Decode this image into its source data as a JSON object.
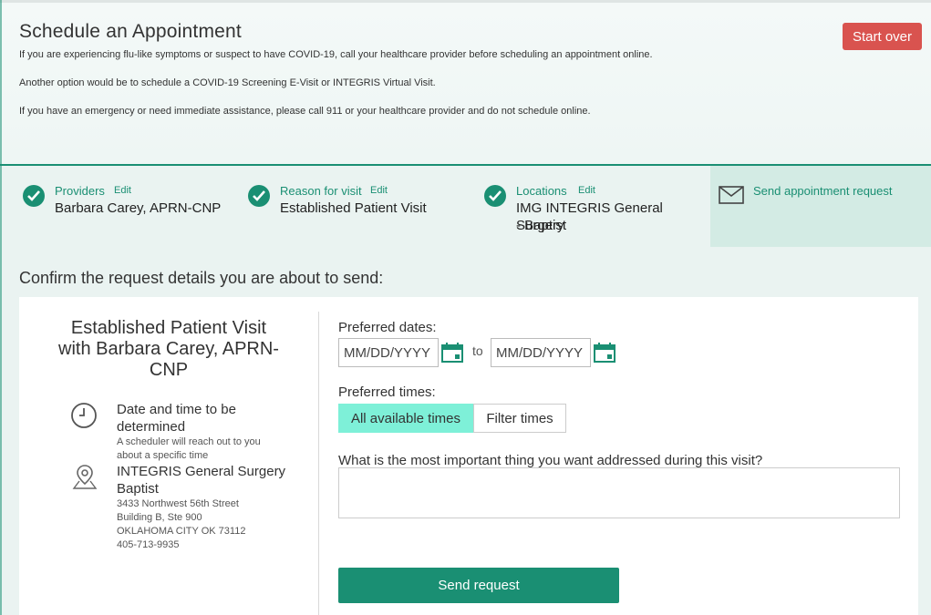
{
  "header": {
    "title": "Schedule an Appointment",
    "notices": [
      "If you are experiencing flu-like symptoms or suspect to have COVID-19, call your healthcare provider before scheduling an appointment online.",
      "Another option would be to schedule a COVID-19 Screening E-Visit or INTEGRIS Virtual Visit.",
      "If you have an emergency or need immediate assistance, please call 911 or your healthcare provider and do not schedule online."
    ],
    "start_over_label": "Start over"
  },
  "steps": [
    {
      "label": "Providers",
      "edit": "Edit",
      "value": "Barbara Carey, APRN-CNP"
    },
    {
      "label": "Reason for visit",
      "edit": "Edit",
      "value": "Established Patient Visit"
    },
    {
      "label": "Locations",
      "edit": "Edit",
      "value_line1": "IMG INTEGRIS General Surgery",
      "value_line2": "- Baptist"
    },
    {
      "label": "Send appointment request"
    }
  ],
  "confirm_heading": "Confirm the request details you are about to send:",
  "summary": {
    "visit_line1": "Established Patient Visit",
    "visit_line2": "with Barbara Carey, APRN-",
    "visit_line3": "CNP",
    "datetime_line1": "Date and time to be",
    "datetime_line2": "determined",
    "datetime_note_line1": "A scheduler will reach out to you",
    "datetime_note_line2": "about a specific time",
    "location_line1": "INTEGRIS General Surgery",
    "location_line2": "Baptist",
    "address": [
      "3433 Northwest 56th Street",
      "Building B, Ste 900",
      "OKLAHOMA CITY OK 73112",
      "405-713-9935"
    ]
  },
  "form": {
    "preferred_dates_label": "Preferred dates:",
    "date_placeholder": "MM/DD/YYYY",
    "to_label": "to",
    "preferred_times_label": "Preferred times:",
    "all_times_label": "All available times",
    "filter_times_label": "Filter times",
    "concern_label": "What is the most important thing you want addressed during this visit?",
    "send_label": "Send request"
  },
  "colors": {
    "accent": "#1a8f73",
    "start_over": "#d9534f",
    "selected_toggle": "#7ef0d8",
    "active_step_bg": "#d3ebe4"
  }
}
